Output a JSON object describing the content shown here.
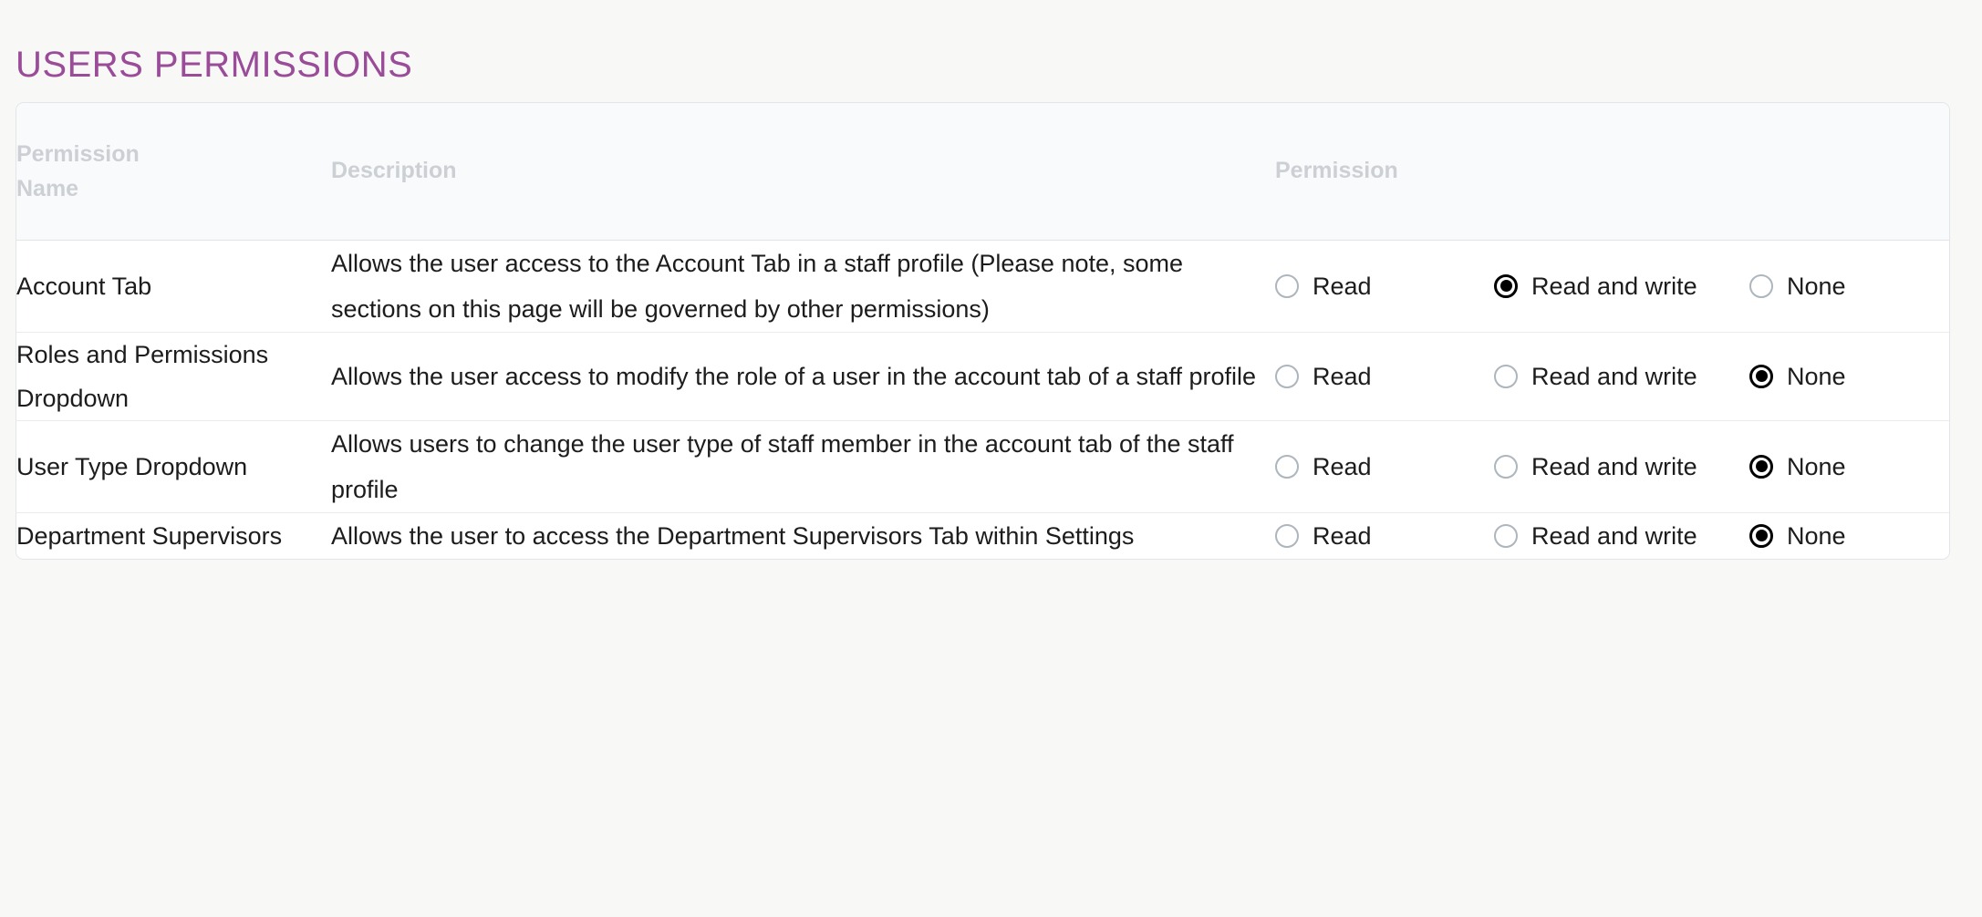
{
  "page": {
    "title": "USERS PERMISSIONS",
    "accent_color": "#9a4c99",
    "background_color": "#f8f8f7"
  },
  "table": {
    "columns": {
      "name": "Permission Name",
      "name_line1": "Permission",
      "name_line2": "Name",
      "description": "Description",
      "permission": "Permission"
    },
    "options": {
      "read": "Read",
      "read_and_write": "Read and write",
      "none": "None"
    },
    "rows": [
      {
        "name": "Account Tab",
        "description": "Allows the user access to the Account Tab in a staff profile (Please note, some sections on this page will be governed by other permissions)",
        "selected": "read_and_write"
      },
      {
        "name": "Roles and Permissions Dropdown",
        "description": "Allows the user access to modify the role of a user in the account tab of a staff profile",
        "selected": "none"
      },
      {
        "name": "User Type Dropdown",
        "description": "Allows users to change the user type of staff member in the account tab of the staff profile",
        "selected": "none"
      },
      {
        "name": "Department Supervisors",
        "description": "Allows the user to access the Department Supervisors Tab within Settings",
        "selected": "none"
      }
    ]
  }
}
